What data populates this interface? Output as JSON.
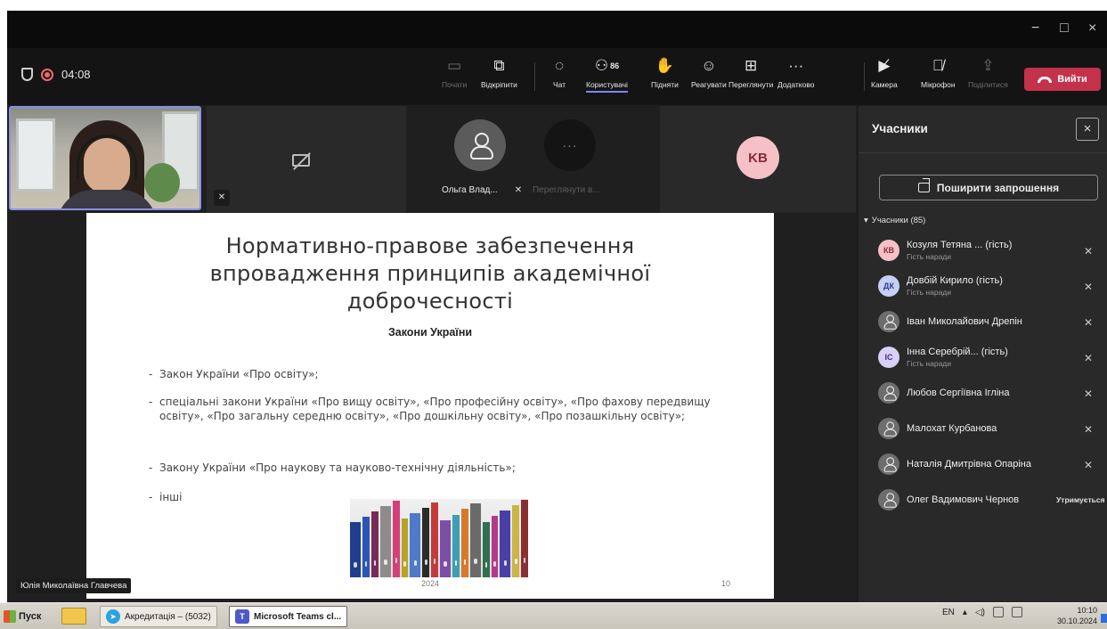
{
  "window": {
    "controls": [
      "−",
      "□",
      "×"
    ]
  },
  "meeting": {
    "timer": "04:08"
  },
  "toolbar": {
    "items": [
      {
        "label": "Почати",
        "icon": "screen-record-icon",
        "disabled": true
      },
      {
        "label": "Відкріпити",
        "icon": "unpin-window-icon"
      },
      {
        "label": "Чат",
        "icon": "chat-icon"
      },
      {
        "label": "Користувачі",
        "icon": "people-icon",
        "count": "86",
        "active": true
      },
      {
        "label": "Підняти",
        "icon": "raise-hand-icon"
      },
      {
        "label": "Реагувати",
        "icon": "smiley-icon"
      },
      {
        "label": "Переглянути",
        "icon": "view-grid-icon"
      },
      {
        "label": "Додатково",
        "icon": "more-icon"
      },
      {
        "label": "Камера",
        "icon": "camera-off-icon"
      },
      {
        "label": "Мікрофон",
        "icon": "mic-off-icon"
      },
      {
        "label": "Поділитися",
        "icon": "share-screen-icon",
        "disabled": true
      }
    ],
    "leave_label": "Вийти"
  },
  "video_strip": {
    "name_1": "Ольга Влад...",
    "name_2": "Переглянути в...",
    "kb_initials": "KB"
  },
  "slide": {
    "title_line_1": "Нормативно-правове забезпечення",
    "title_line_2": "впровадження принципів академічної",
    "title_line_3": "доброчесності",
    "subtitle": "Закони України",
    "bullets": [
      "Закон України «Про освіту»;",
      "спеціальні закони України «Про вищу освіту», «Про професійну освіту», «Про фахову передвищу освіту», «Про загальну середню освіту», «Про дошкільну освіту», «Про позашкільну освіту»;",
      "Закону України «Про наукову та науково-технічну діяльність»;",
      "інші"
    ],
    "year": "2024",
    "page": "10",
    "binder_colors": [
      "#1f3f8c",
      "#2b56b5",
      "#7a2a58",
      "#8c8c8c",
      "#d43f7a",
      "#b7a326",
      "#4f79c9",
      "#2b2b2b",
      "#c23b3b",
      "#7b4fa6",
      "#3aa0b5",
      "#d67a2a",
      "#6a6a6a",
      "#2f6f4f",
      "#b33a8a",
      "#4a3fa6",
      "#c9b54a",
      "#8a2f2f"
    ]
  },
  "presenter_label": "Юлія Миколаївна Главчева",
  "panel": {
    "title": "Учасники",
    "close": "×",
    "invite_label": "Поширити запрошення",
    "section_label": "Учасники (85)",
    "participants": [
      {
        "name": "Козуля Тетяна ... (гість)",
        "sub": "Гість наради",
        "initials": "КВ",
        "ava_bg": "#f5c1c6",
        "ava_fg": "#8a2a3a"
      },
      {
        "name": "Довбій Кирило (гість)",
        "sub": "Гість наради",
        "initials": "ДК",
        "ava_bg": "#c5d0f5",
        "ava_fg": "#2a3a8a"
      },
      {
        "name": "Іван Миколайович Дрепін",
        "sub": "",
        "initials": "",
        "ava_bg": "#6d6d6d",
        "ava_fg": "#ececec"
      },
      {
        "name": "Інна Серебрій... (гість)",
        "sub": "Гість наради",
        "initials": "ІС",
        "ava_bg": "#d9d0f5",
        "ava_fg": "#4a2a8a"
      },
      {
        "name": "Любов Сергіївна Ігліна",
        "sub": "",
        "initials": "",
        "ava_bg": "#6d6d6d",
        "ava_fg": "#ececec"
      },
      {
        "name": "Малохат Курбанова",
        "sub": "",
        "initials": "",
        "ava_bg": "#6d6d6d",
        "ava_fg": "#ececec"
      },
      {
        "name": "Наталія Дмитрівна Опаріна",
        "sub": "",
        "initials": "",
        "ava_bg": "#6d6d6d",
        "ava_fg": "#ececec"
      },
      {
        "name": "Олег Вадимович Чернов",
        "sub": "",
        "initials": "",
        "ava_bg": "#6d6d6d",
        "ava_fg": "#ececec",
        "status": "Утримується"
      }
    ]
  },
  "taskbar": {
    "start_label": "Пуск",
    "telegram_label": "Акредитація – (5032)",
    "teams_label": "Microsoft Teams cl...",
    "lang": "EN",
    "time": "10:10",
    "date": "30.10.2024"
  }
}
